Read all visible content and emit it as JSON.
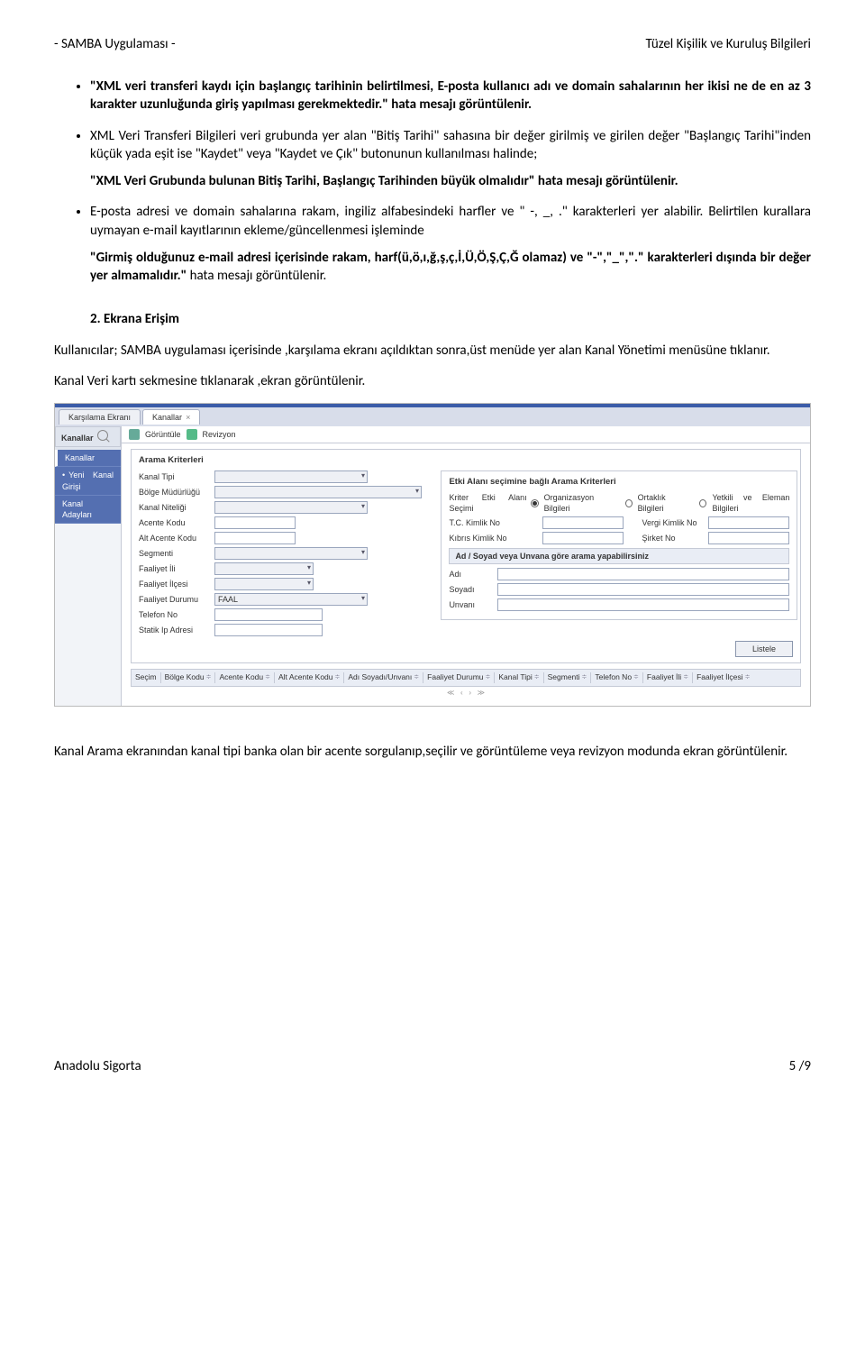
{
  "header": {
    "left": "- SAMBA Uygulaması -",
    "right": "Tüzel Kişilik ve Kuruluş Bilgileri"
  },
  "doc": {
    "bullet1": "\"XML veri transferi kaydı için başlangıç tarihinin belirtilmesi, E-posta kullanıcı adı ve domain sahalarının her ikisi ne de en az 3 karakter uzunluğunda giriş yapılması gerekmektedir.\" hata mesajı görüntülenir.",
    "bullet2": "XML Veri Transferi Bilgileri veri grubunda yer alan \"Bitiş Tarihi\" sahasına bir değer girilmiş ve girilen değer \"Başlangıç Tarihi\"inden küçük yada eşit ise \"Kaydet\" veya \"Kaydet ve Çık\" butonunun kullanılması halinde;",
    "bullet2_sub": "\"XML Veri Grubunda bulunan Bitiş Tarihi, Başlangıç Tarihinden büyük olmalıdır\" hata mesajı görüntülenir.",
    "bullet3a": "E-posta adresi ve domain sahalarına rakam, ingiliz alfabesindeki harfler  ve \" -, _, .\" karakterleri yer alabilir. Belirtilen kurallara uymayan e-mail kayıtlarının ekleme/güncellenmesi işleminde",
    "bullet3b_bold": "\"Girmiş olduğunuz e-mail adresi içerisinde rakam, harf(ü,ö,ı,ğ,ş,ç,İ,Ü,Ö,Ş,Ç,Ğ olamaz) ve  \"-\",\"_\",\".\" karakterleri dışında bir değer yer almamalıdır.\"",
    "bullet3b_rest": "  hata mesajı görüntülenir.",
    "num2": "2.   Ekrana Erişim",
    "p1": "Kullanıcılar; SAMBA uygulaması içerisinde ,karşılama ekranı açıldıktan sonra,üst menüde yer alan Kanal Yönetimi menüsüne tıklanır.",
    "p2": "Kanal Veri kartı sekmesine tıklanarak ,ekran görüntülenir.",
    "p3": "Kanal Arama ekranından kanal tipi banka olan bir acente sorgulanıp,seçilir ve görüntüleme veya revizyon modunda ekran görüntülenir."
  },
  "ui": {
    "tab1": "Karşılama Ekranı",
    "tab2": "Kanallar",
    "side_hd": "Kanallar",
    "side_items": [
      "Kanallar",
      "Yeni Kanal Girişi",
      "Kanal Adayları"
    ],
    "tool1": "Görüntüle",
    "tool2": "Revizyon",
    "panel1": "Arama Kriterleri",
    "panel2": "Etki Alanı seçimine bağlı Arama Kriterleri",
    "labels": {
      "kanal_tipi": "Kanal Tipi",
      "bolge": "Bölge Müdürlüğü",
      "nitelik": "Kanal Niteliği",
      "akodu": "Acente Kodu",
      "altkodu": "Alt Acente Kodu",
      "seg": "Segmenti",
      "fil": "Faaliyet İli",
      "filce": "Faaliyet İlçesi",
      "fdurum": "Faaliyet Durumu",
      "tel": "Telefon No",
      "ip": "Statik Ip Adresi",
      "kriter": "Kriter Etki Alanı Seçimi",
      "r1": "Organizasyon Bilgileri",
      "r2": "Ortaklık Bilgileri",
      "r3": "Yetkili ve Eleman Bilgileri",
      "tc": "T.C. Kimlik No",
      "vergi": "Vergi Kimlik No",
      "kibris": "Kıbrıs Kimlik No",
      "sirket": "Şirket No",
      "subhd": "Ad / Soyad veya Unvana göre arama yapabilirsiniz",
      "adi": "Adı",
      "soyadi": "Soyadı",
      "unvani": "Unvanı",
      "faal": "FAAL"
    },
    "listele": "Listele",
    "cols": [
      "Seçim",
      "Bölge Kodu",
      "Acente Kodu",
      "Alt Acente Kodu",
      "Adı Soyadı/Unvanı",
      "Faaliyet Durumu",
      "Kanal Tipi",
      "Segmenti",
      "Telefon No",
      "Faaliyet İli",
      "Faaliyet İlçesi"
    ]
  },
  "footer": {
    "left": "Anadolu Sigorta",
    "right": "5 /9"
  }
}
